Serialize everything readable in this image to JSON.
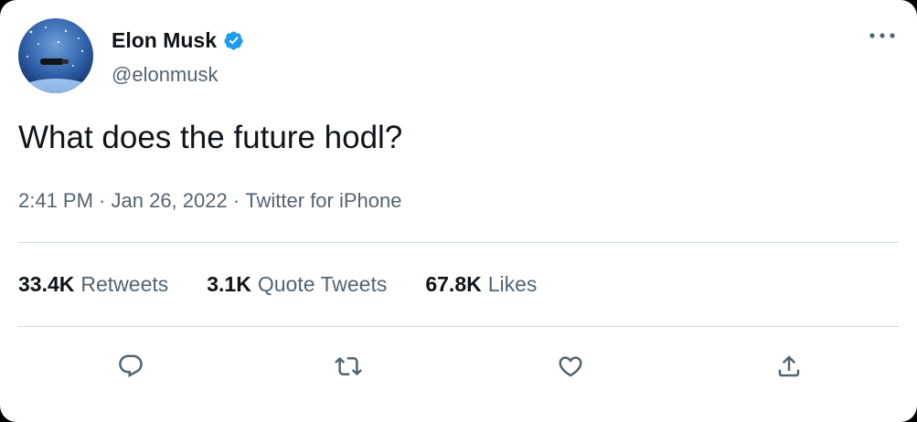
{
  "author": {
    "display_name": "Elon Musk",
    "handle": "@elonmusk",
    "verified": true
  },
  "tweet": {
    "text": "What does the future hodl?",
    "time": "2:41 PM",
    "separator": " · ",
    "date": "Jan 26, 2022",
    "source": "Twitter for iPhone"
  },
  "stats": [
    {
      "count": "33.4K",
      "label": "Retweets"
    },
    {
      "count": "3.1K",
      "label": "Quote Tweets"
    },
    {
      "count": "67.8K",
      "label": "Likes"
    }
  ],
  "icons": {
    "more": "more-icon",
    "verified": "verified-badge-icon",
    "reply": "reply-icon",
    "retweet": "retweet-icon",
    "like": "heart-icon",
    "share": "share-icon"
  },
  "colors": {
    "text_primary": "#0f1419",
    "text_secondary": "#536471",
    "verified_blue": "#1d9bf0",
    "divider": "#cfd9de",
    "background": "#ffffff"
  }
}
